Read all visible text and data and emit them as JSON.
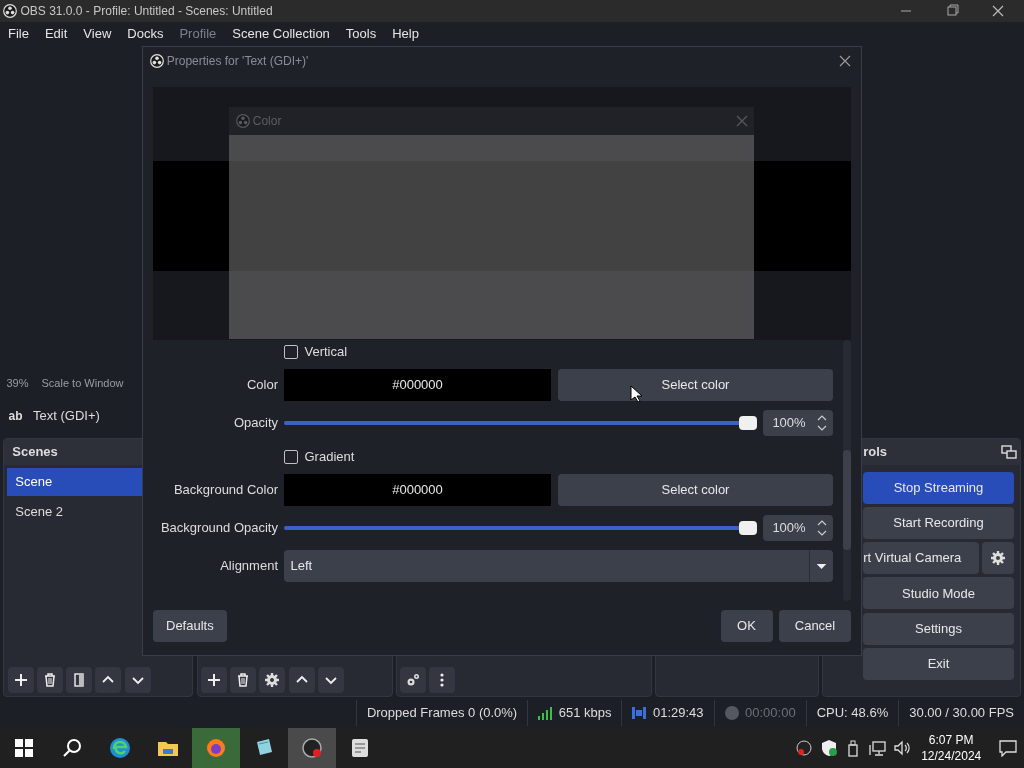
{
  "window": {
    "title": "OBS 31.0.0 - Profile: Untitled - Scenes: Untitled"
  },
  "menu": [
    {
      "label": "File",
      "disabled": false
    },
    {
      "label": "Edit",
      "disabled": false
    },
    {
      "label": "View",
      "disabled": false
    },
    {
      "label": "Docks",
      "disabled": false
    },
    {
      "label": "Profile",
      "disabled": true
    },
    {
      "label": "Scene Collection",
      "disabled": false
    },
    {
      "label": "Tools",
      "disabled": false
    },
    {
      "label": "Help",
      "disabled": false
    }
  ],
  "preview": {
    "zoom": "39%",
    "scale_mode": "Scale to Window"
  },
  "source_toolbar": {
    "type_icon": "ab",
    "source": "Text (GDI+)"
  },
  "scenes": {
    "title": "Scenes",
    "items": [
      {
        "label": "Scene",
        "selected": true
      },
      {
        "label": "Scene 2",
        "selected": false
      }
    ]
  },
  "controls": {
    "title": "rols",
    "buttons": [
      {
        "label": "Stop Streaming",
        "active": true,
        "kind": "button"
      },
      {
        "label": "Start Recording",
        "active": false,
        "kind": "button"
      },
      {
        "label": "rt Virtual Camera",
        "active": false,
        "kind": "split"
      },
      {
        "label": "Studio Mode",
        "active": false,
        "kind": "button"
      },
      {
        "label": "Settings",
        "active": false,
        "kind": "button"
      },
      {
        "label": "Exit",
        "active": false,
        "kind": "button"
      }
    ]
  },
  "properties_dialog": {
    "title": "Properties for 'Text (GDI+)'",
    "fields": [
      {
        "kind": "checkbox",
        "label": "Vertical",
        "checked": false
      },
      {
        "kind": "color",
        "label": "Color",
        "value": "#000000",
        "button": "Select color"
      },
      {
        "kind": "slider",
        "label": "Opacity",
        "level": 1.0,
        "reading": "100%"
      },
      {
        "kind": "checkbox",
        "label": "Gradient",
        "checked": false
      },
      {
        "kind": "color",
        "label": "Background Color",
        "value": "#000000",
        "button": "Select color"
      },
      {
        "kind": "slider",
        "label": "Background Opacity",
        "level": 1.0,
        "reading": "100%"
      },
      {
        "kind": "select",
        "label": "Alignment",
        "value": "Left"
      }
    ],
    "defaults": "Defaults",
    "ok": "OK",
    "cancel": "Cancel"
  },
  "color_dialog": {
    "title": "Color"
  },
  "status_bar": {
    "dropped_frames": "Dropped Frames 0 (0.0%)",
    "bitrate": "651 kbps",
    "streaming": true,
    "stream_time": "01:29:43",
    "recording": false,
    "record_time": "00:00:00",
    "cpu": "CPU: 48.6%",
    "fps": "30.00 / 30.00 FPS"
  },
  "taskbar": {
    "time": "6:07 PM",
    "date": "12/24/2024"
  }
}
